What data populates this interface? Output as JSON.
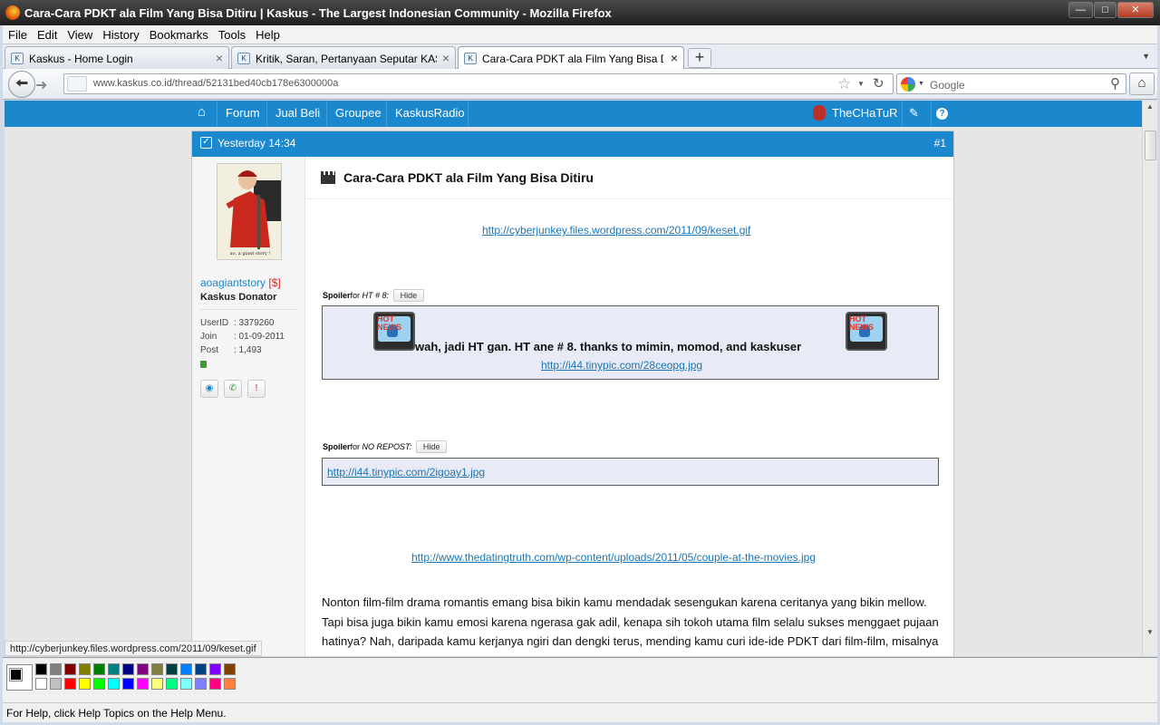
{
  "window": {
    "title": "Cara-Cara PDKT ala Film Yang Bisa Ditiru | Kaskus - The Largest Indonesian Community - Mozilla Firefox"
  },
  "menu": [
    "File",
    "Edit",
    "View",
    "History",
    "Bookmarks",
    "Tools",
    "Help"
  ],
  "tabs": [
    {
      "label": "Kaskus - Home Login"
    },
    {
      "label": "Kritik, Saran, Pertanyaan Seputar KASK..."
    },
    {
      "label": "Cara-Cara PDKT ala Film Yang Bisa Ditir..."
    }
  ],
  "nav": {
    "url": "www.kaskus.co.id/thread/52131bed40cb178e6300000a",
    "search_placeholder": "Google"
  },
  "site_nav": {
    "items": [
      "Forum",
      "Jual Beli",
      "Groupee",
      "KaskusRadio"
    ],
    "user": "TheCHaTuR"
  },
  "post": {
    "time": "Yesterday 14:34",
    "number": "#1",
    "title": "Cara-Cara PDKT ala Film Yang Bisa Ditiru",
    "link1": "http://cyberjunkey.files.wordpress.com/2011/09/keset.gif",
    "spoiler1": {
      "label": "Spoiler",
      "for": "for",
      "name": "HT # 8:",
      "hide": "Hide"
    },
    "ht_text": "wah, jadi HT gan. HT ane # 8. thanks to mimin, momod, and kaskuser",
    "ht_link": "http://i44.tinypic.com/28ceopg.jpg",
    "spoiler2": {
      "label": "Spoiler",
      "for": "for",
      "name": "NO REPOST:",
      "hide": "Hide"
    },
    "repost_link": "http://i44.tinypic.com/2igoay1.jpg",
    "link2": "http://www.thedatingtruth.com/wp-content/uploads/2011/05/couple-at-the-movies.jpg",
    "paragraph": "Nonton film-film drama romantis emang bisa bikin kamu mendadak sesengukan karena ceritanya yang bikin mellow. Tapi bisa juga bikin kamu emosi karena ngerasa gak adil, kenapa sih tokoh utama film selalu sukses menggaet pujaan hatinya? Nah, daripada kamu kerjanya ngiri dan dengki terus, mending kamu curi ide-ide PDKT dari film-film, misalnya kayak:"
  },
  "user": {
    "avatar_caption": "ao, a giant story !",
    "name": "aoagiantstory",
    "donor_tag": "[$]",
    "rank": "Kaskus Donator",
    "stats": [
      {
        "key": "UserID",
        "value": ": 3379260"
      },
      {
        "key": "Join",
        "value": ": 01-09-2011"
      },
      {
        "key": "Post",
        "value": ": 1,493"
      }
    ]
  },
  "status_link": "http://cyberjunkey.files.wordpress.com/2011/09/keset.gif",
  "palette": {
    "top": [
      "#000000",
      "#808080",
      "#800000",
      "#808000",
      "#008000",
      "#008080",
      "#000080",
      "#800080",
      "#808040",
      "#004040",
      "#0080ff",
      "#004080",
      "#8000ff",
      "#804000"
    ],
    "bottom": [
      "#ffffff",
      "#c0c0c0",
      "#ff0000",
      "#ffff00",
      "#00ff00",
      "#00ffff",
      "#0000ff",
      "#ff00ff",
      "#ffff80",
      "#00ff80",
      "#80ffff",
      "#8080ff",
      "#ff0080",
      "#ff8040"
    ]
  },
  "statusbar": "For Help, click Help Topics on the Help Menu."
}
